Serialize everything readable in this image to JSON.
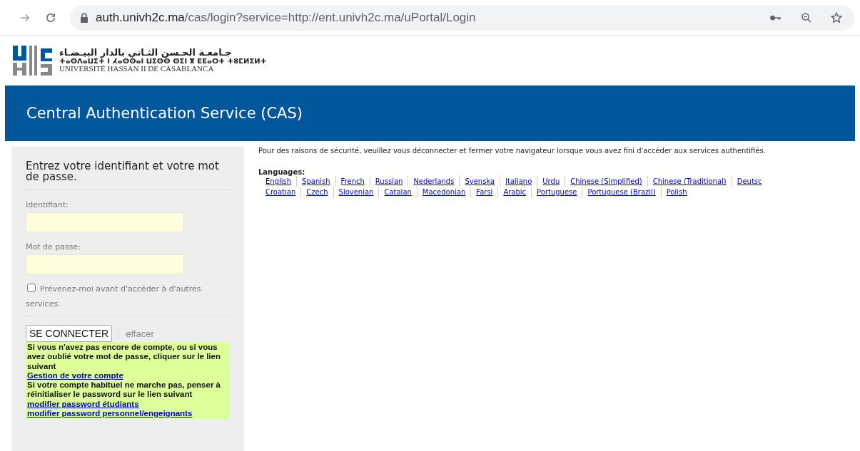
{
  "browser": {
    "url_host": "auth.univh2c.ma",
    "url_path": "/cas/login?service=http://ent.univh2c.ma/uPortal/Login"
  },
  "logo": {
    "arabic": "جـامعـة الحـسن الثـاني بالدار البيـضـاء",
    "tifinagh": "ⵜⴰⵙⴷⴰⵡⵉⵜ ⵏ ⵃⴰⵙⵙⴰⵏ ⵡⵉⵙⵙ ⵙⵉⵏ ⴳ ⴹⴹⴰⵔⵜ ⵜⵓⵎⵍⵉⵍⵜ",
    "french": "UNIVERSITÉ HASSAN II DE CASABLANCA"
  },
  "header": {
    "title": "Central Authentication Service (CAS)"
  },
  "login": {
    "heading": "Entrez votre identifiant et votre mot de passe.",
    "fields": [
      {
        "label": "Identifiant:"
      },
      {
        "label": "Mot de passe:"
      }
    ],
    "remember": {
      "label": "Prévenez-moi avant d'accéder à d'autres services.",
      "checked": false
    },
    "submit": "SE CONNECTER",
    "clear": "effacer",
    "notice": [
      {
        "kind": "text",
        "text": "Si vous n'avez pas encore de compte, ou si vous avez oublié votre mot de passe, cliquer sur le lien suivant"
      },
      {
        "kind": "link",
        "text": "Gestion de votre compte"
      },
      {
        "kind": "text",
        "text": "Si votre compte habituel ne marche pas, penser à réinitialiser le password sur le lien suivant"
      },
      {
        "kind": "link",
        "text": "modifier password étudiants"
      },
      {
        "kind": "link",
        "text": "modifier password personnel/engeignants"
      }
    ]
  },
  "security_message": "Pour des raisons de sécurité, veuillez vous déconnecter et fermer votre navigateur lorsque vous avez fini d'accéder aux services authentifiés.",
  "languages": {
    "label": "Languages:",
    "rows": [
      [
        "English",
        "Spanish",
        "French",
        "Russian",
        "Nederlands",
        "Svenska",
        "Italiano",
        "Urdu",
        "Chinese (Simplified)",
        "Chinese (Traditional)",
        "Deutsc"
      ],
      [
        "Croatian",
        "Czech",
        "Slovenian",
        "Catalan",
        "Macedonian",
        "Farsi",
        "Arabic",
        "Portuguese",
        "Portuguese (Brazil)",
        "Polish"
      ]
    ]
  }
}
